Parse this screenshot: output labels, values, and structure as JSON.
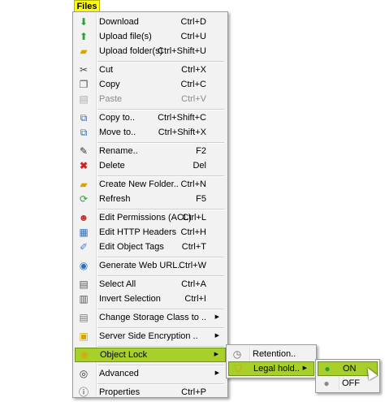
{
  "menubar": {
    "files_label": "Files"
  },
  "files_menu": {
    "items": [
      {
        "label": "Download",
        "shortcut": "Ctrl+D",
        "icon": "download-icon"
      },
      {
        "label": "Upload file(s)",
        "shortcut": "Ctrl+U",
        "icon": "upload-icon"
      },
      {
        "label": "Upload folder(s)",
        "shortcut": "Ctrl+Shift+U",
        "icon": "upload-folder-icon"
      },
      {
        "label": "Cut",
        "shortcut": "Ctrl+X",
        "icon": "scissors-icon"
      },
      {
        "label": "Copy",
        "shortcut": "Ctrl+C",
        "icon": "copy-icon"
      },
      {
        "label": "Paste",
        "shortcut": "Ctrl+V",
        "icon": "paste-icon"
      },
      {
        "label": "Copy to..",
        "shortcut": "Ctrl+Shift+C",
        "icon": "copy-to-icon"
      },
      {
        "label": "Move to..",
        "shortcut": "Ctrl+Shift+X",
        "icon": "move-to-icon"
      },
      {
        "label": "Rename..",
        "shortcut": "F2",
        "icon": "pencil-icon"
      },
      {
        "label": "Delete",
        "shortcut": "Del",
        "icon": "delete-x-icon"
      },
      {
        "label": "Create New Folder..",
        "shortcut": "Ctrl+N",
        "icon": "new-folder-icon"
      },
      {
        "label": "Refresh",
        "shortcut": "F5",
        "icon": "refresh-icon"
      },
      {
        "label": "Edit Permissions (ACL)",
        "shortcut": "Ctrl+L",
        "icon": "users-icon"
      },
      {
        "label": "Edit HTTP Headers",
        "shortcut": "Ctrl+H",
        "icon": "headers-icon"
      },
      {
        "label": "Edit Object Tags",
        "shortcut": "Ctrl+T",
        "icon": "tag-icon"
      },
      {
        "label": "Generate Web URL..",
        "shortcut": "Ctrl+W",
        "icon": "web-url-icon"
      },
      {
        "label": "Select All",
        "shortcut": "Ctrl+A",
        "icon": "select-all-icon"
      },
      {
        "label": "Invert Selection",
        "shortcut": "Ctrl+I",
        "icon": "invert-selection-icon"
      },
      {
        "label": "Change Storage Class to ..",
        "shortcut": "",
        "icon": "storage-class-icon"
      },
      {
        "label": "Server Side Encryption ..",
        "shortcut": "",
        "icon": "encryption-icon"
      },
      {
        "label": "Object Lock",
        "shortcut": "",
        "icon": "object-lock-icon"
      },
      {
        "label": "Advanced",
        "shortcut": "",
        "icon": "advanced-icon"
      },
      {
        "label": "Properties",
        "shortcut": "Ctrl+P",
        "icon": "properties-icon"
      }
    ]
  },
  "object_lock_submenu": {
    "items": [
      {
        "label": "Retention..",
        "icon": "clock-icon"
      },
      {
        "label": "Legal hold..",
        "icon": "shield-icon"
      }
    ]
  },
  "legal_hold_submenu": {
    "items": [
      {
        "label": "ON",
        "icon": "green-circle-icon"
      },
      {
        "label": "OFF",
        "icon": "gray-circle-icon"
      }
    ]
  },
  "colors": {
    "highlight": "#a8cf2a",
    "menubar_active": "#ffff00"
  }
}
